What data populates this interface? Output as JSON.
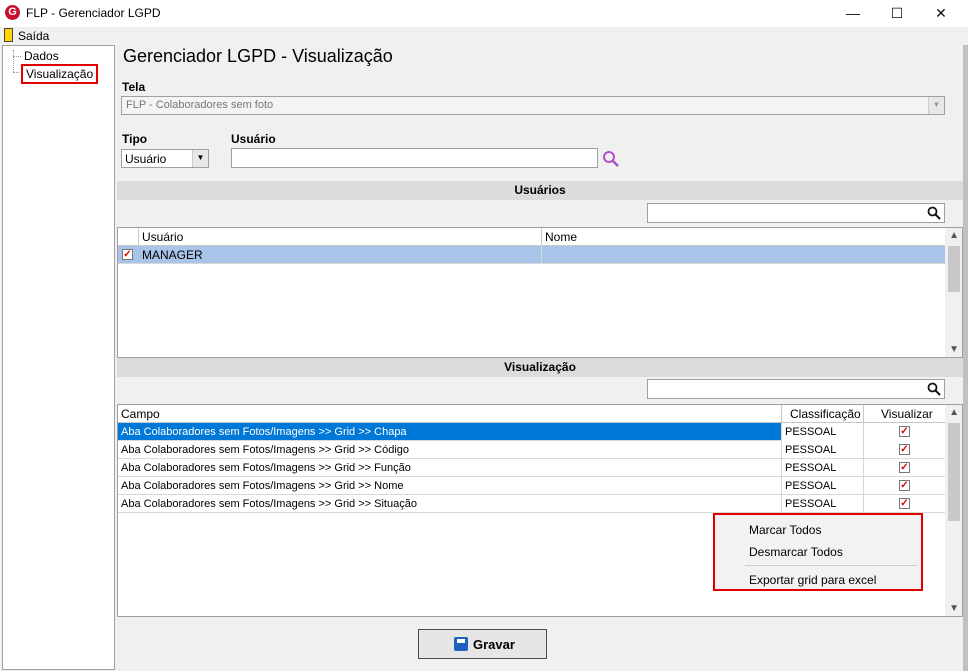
{
  "window": {
    "title": "FLP - Gerenciador LGPD",
    "icon_letter": "G",
    "minimize": "—",
    "maximize": "☐",
    "close": "✕"
  },
  "menu": {
    "exit_label": "Saída"
  },
  "tree": {
    "items": [
      "Dados",
      "Visualização"
    ]
  },
  "page_title": "Gerenciador LGPD - Visualização",
  "tela": {
    "label": "Tela",
    "value": "FLP - Colaboradores sem foto"
  },
  "tipo": {
    "label": "Tipo",
    "value": "Usuário"
  },
  "usuario": {
    "label": "Usuário",
    "value": ""
  },
  "users_section": {
    "title": "Usuários",
    "columns": [
      "Usuário",
      "Nome"
    ],
    "rows": [
      {
        "usuario": "MANAGER",
        "nome": "",
        "checked": true
      }
    ]
  },
  "vis_section": {
    "title": "Visualização",
    "columns": [
      "Campo",
      "Classificação",
      "Visualizar"
    ],
    "rows": [
      {
        "campo": "Aba Colaboradores sem Fotos/Imagens >> Grid >> Chapa",
        "classificacao": "PESSOAL",
        "visualizar": true
      },
      {
        "campo": "Aba Colaboradores sem Fotos/Imagens >> Grid >> Código",
        "classificacao": "PESSOAL",
        "visualizar": true
      },
      {
        "campo": "Aba Colaboradores sem Fotos/Imagens >> Grid >> Função",
        "classificacao": "PESSOAL",
        "visualizar": true
      },
      {
        "campo": "Aba Colaboradores sem Fotos/Imagens >> Grid >> Nome",
        "classificacao": "PESSOAL",
        "visualizar": true
      },
      {
        "campo": "Aba Colaboradores sem Fotos/Imagens >> Grid >> Situação",
        "classificacao": "PESSOAL",
        "visualizar": true
      }
    ]
  },
  "context_menu": {
    "items": [
      "Marcar Todos",
      "Desmarcar Todos",
      "Exportar grid para excel"
    ]
  },
  "save_button": {
    "label": "Gravar"
  },
  "colors": {
    "selection": "#0078d7",
    "highlight_border": "#e00000",
    "user_row": "#a8c4e8"
  }
}
